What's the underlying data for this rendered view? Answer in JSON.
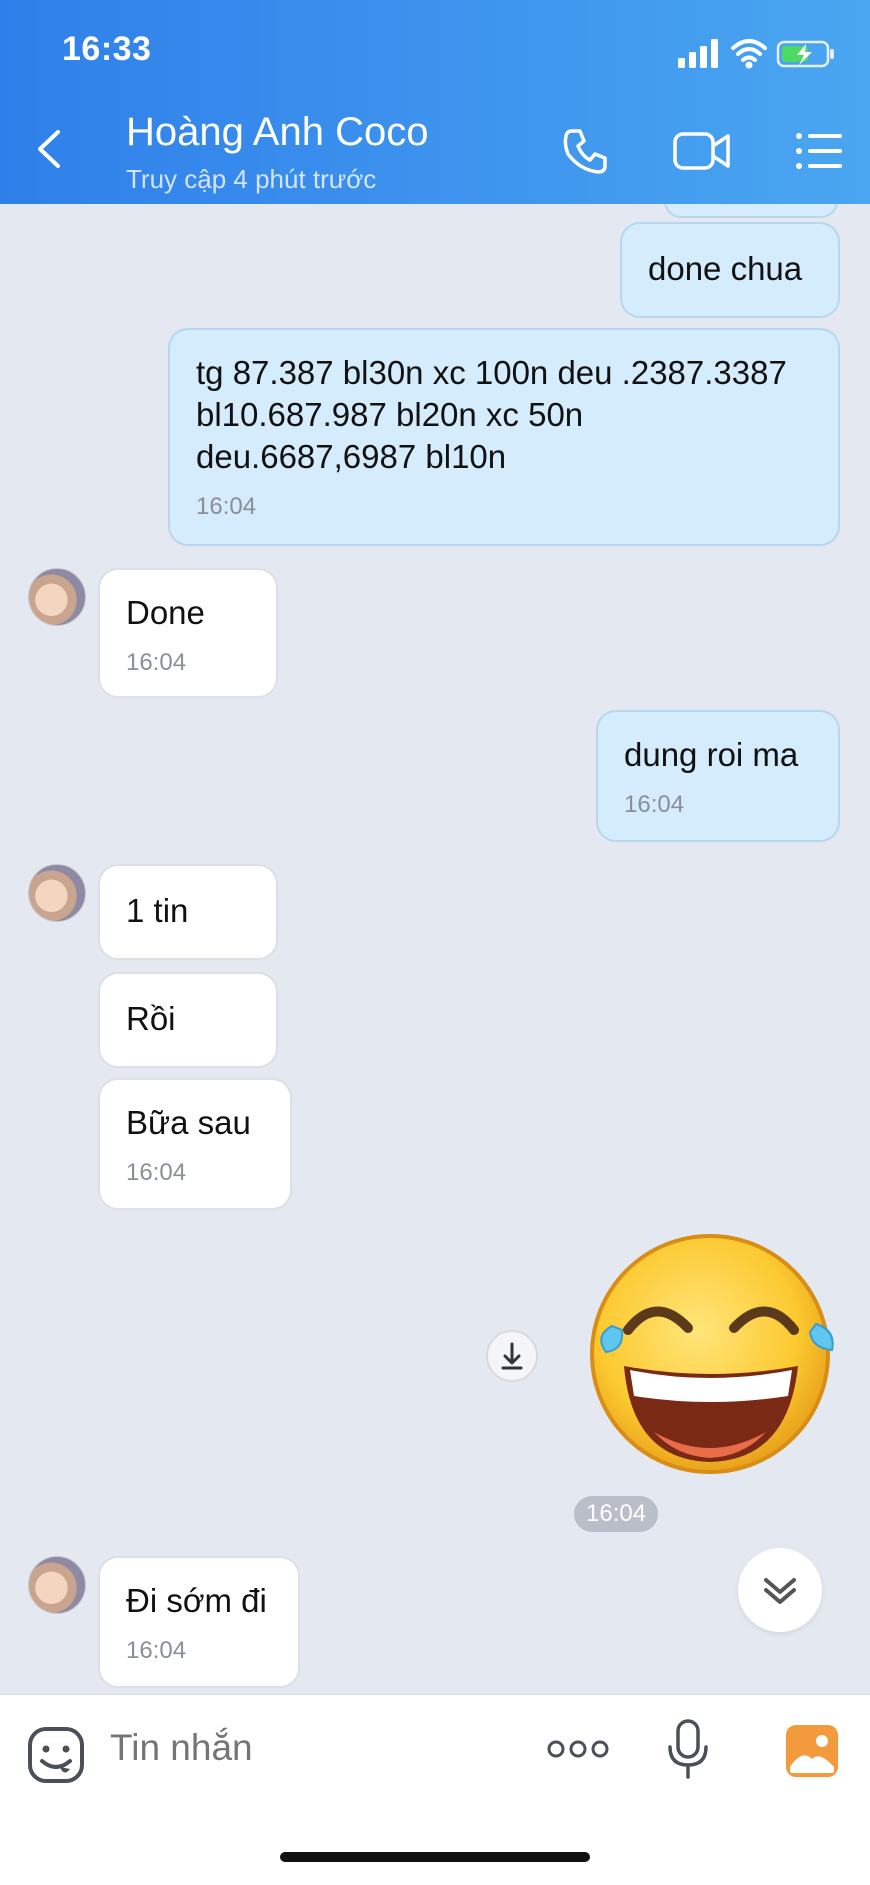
{
  "status_bar": {
    "time": "16:33"
  },
  "header": {
    "title": "Hoàng Anh Coco",
    "subtitle": "Truy cập 4 phút trước"
  },
  "messages": [
    {
      "dir": "out",
      "text": "done chua"
    },
    {
      "dir": "out",
      "text": "tg 87.387 bl30n xc 100n deu .2387.3387 bl10.687.987 bl20n xc 50n deu.6687,6987 bl10n",
      "time": "16:04"
    },
    {
      "dir": "in",
      "text": "Done",
      "time": "16:04"
    },
    {
      "dir": "out",
      "text": "dung roi ma",
      "time": "16:04"
    },
    {
      "dir": "in",
      "text": "1 tin"
    },
    {
      "dir": "in",
      "text": "Rồi"
    },
    {
      "dir": "in",
      "text": "Bữa sau",
      "time": "16:04"
    },
    {
      "dir": "out",
      "sticker": "laughing-tears-emoji",
      "time": "16:04"
    },
    {
      "dir": "in",
      "text": "Đi sớm đi",
      "time": "16:04"
    }
  ],
  "input": {
    "placeholder": "Tin nhắn"
  },
  "icons": {
    "back": "chevron-left-icon",
    "call": "phone-icon",
    "video": "video-camera-icon",
    "menu": "list-menu-icon",
    "emoji": "emoji-icon",
    "more": "more-dots-icon",
    "mic": "microphone-icon",
    "image": "image-icon",
    "download": "download-icon",
    "scroll": "chevron-double-down-icon"
  },
  "colors": {
    "header_start": "#2f7fea",
    "header_end": "#4aa6f0",
    "outgoing_bubble": "#d5ecfc",
    "incoming_bubble": "#ffffff",
    "chat_bg": "#e4e8f0",
    "image_icon": "#f39a3c"
  }
}
